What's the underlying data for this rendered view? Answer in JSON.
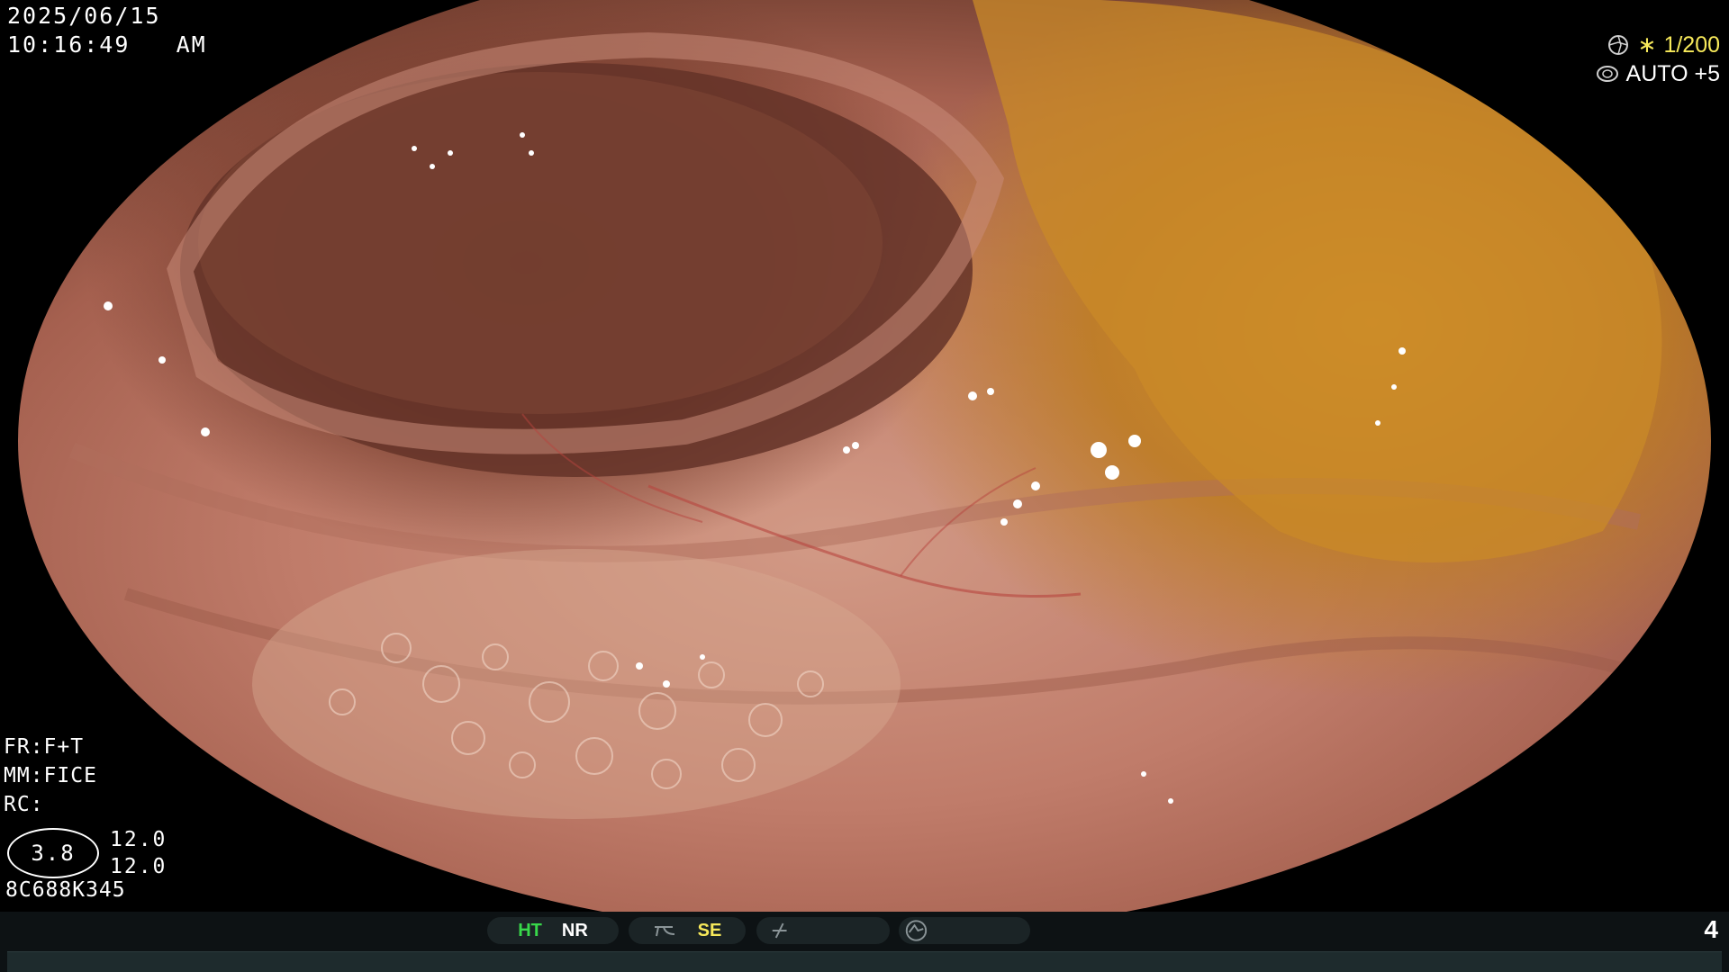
{
  "overlay": {
    "date": "2025/06/15",
    "time": "10:16:49   AM",
    "shutter_prefix": "∗",
    "shutter": "1/200",
    "iris": "AUTO +5",
    "fr": "FR:F+T",
    "mm": "MM:FICE",
    "rc": "RC:",
    "zoom": "3.8",
    "value_1": "12.0",
    "value_2": "12.0",
    "serial": "8C688K345"
  },
  "status_bar": {
    "ht": "HT",
    "nr": "NR",
    "se": "SE",
    "page_number": "4"
  },
  "colors": {
    "green": "#38d84a",
    "yellow": "#f7e95a",
    "white": "#ffffff"
  }
}
